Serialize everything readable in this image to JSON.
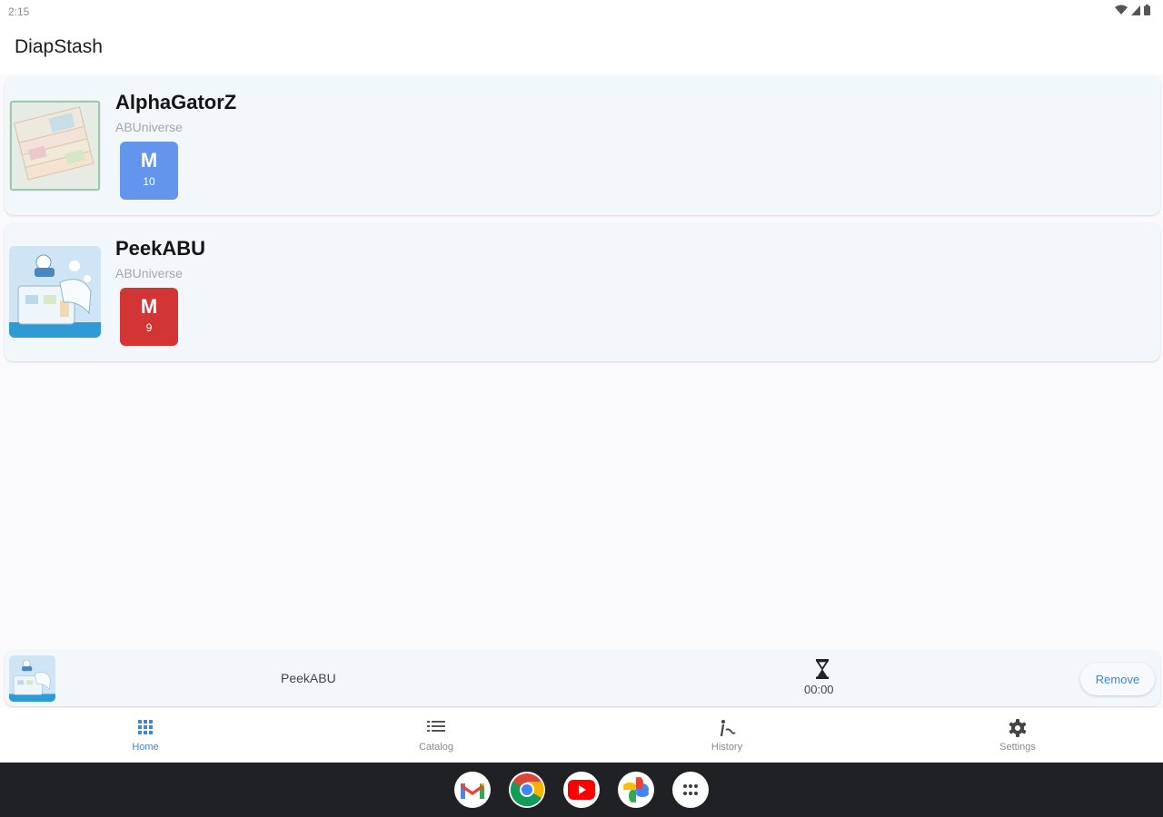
{
  "status_bar": {
    "time": "2:15"
  },
  "app": {
    "title": "DiapStash"
  },
  "cards": [
    {
      "name": "AlphaGatorZ",
      "brand": "ABUniverse",
      "size_letter": "M",
      "count": "10",
      "badge_color": "#6495ed"
    },
    {
      "name": "PeekABU",
      "brand": "ABUniverse",
      "size_letter": "M",
      "count": "9",
      "badge_color": "#d33434"
    }
  ],
  "now_wearing": {
    "name": "PeekABU",
    "timer": "00:00",
    "remove_label": "Remove"
  },
  "nav": {
    "items": [
      {
        "label": "Home",
        "icon": "grid-icon",
        "active": true
      },
      {
        "label": "Catalog",
        "icon": "list-icon",
        "active": false
      },
      {
        "label": "History",
        "icon": "history-icon",
        "active": false
      },
      {
        "label": "Settings",
        "icon": "gear-icon",
        "active": false
      }
    ]
  },
  "dock": {
    "apps": [
      "gmail-icon",
      "chrome-icon",
      "youtube-icon",
      "photos-icon",
      "app-drawer-icon"
    ]
  },
  "colors": {
    "accent": "#3e86d9",
    "card_bg": "#f2f7fc",
    "system_bar": "#202124"
  }
}
